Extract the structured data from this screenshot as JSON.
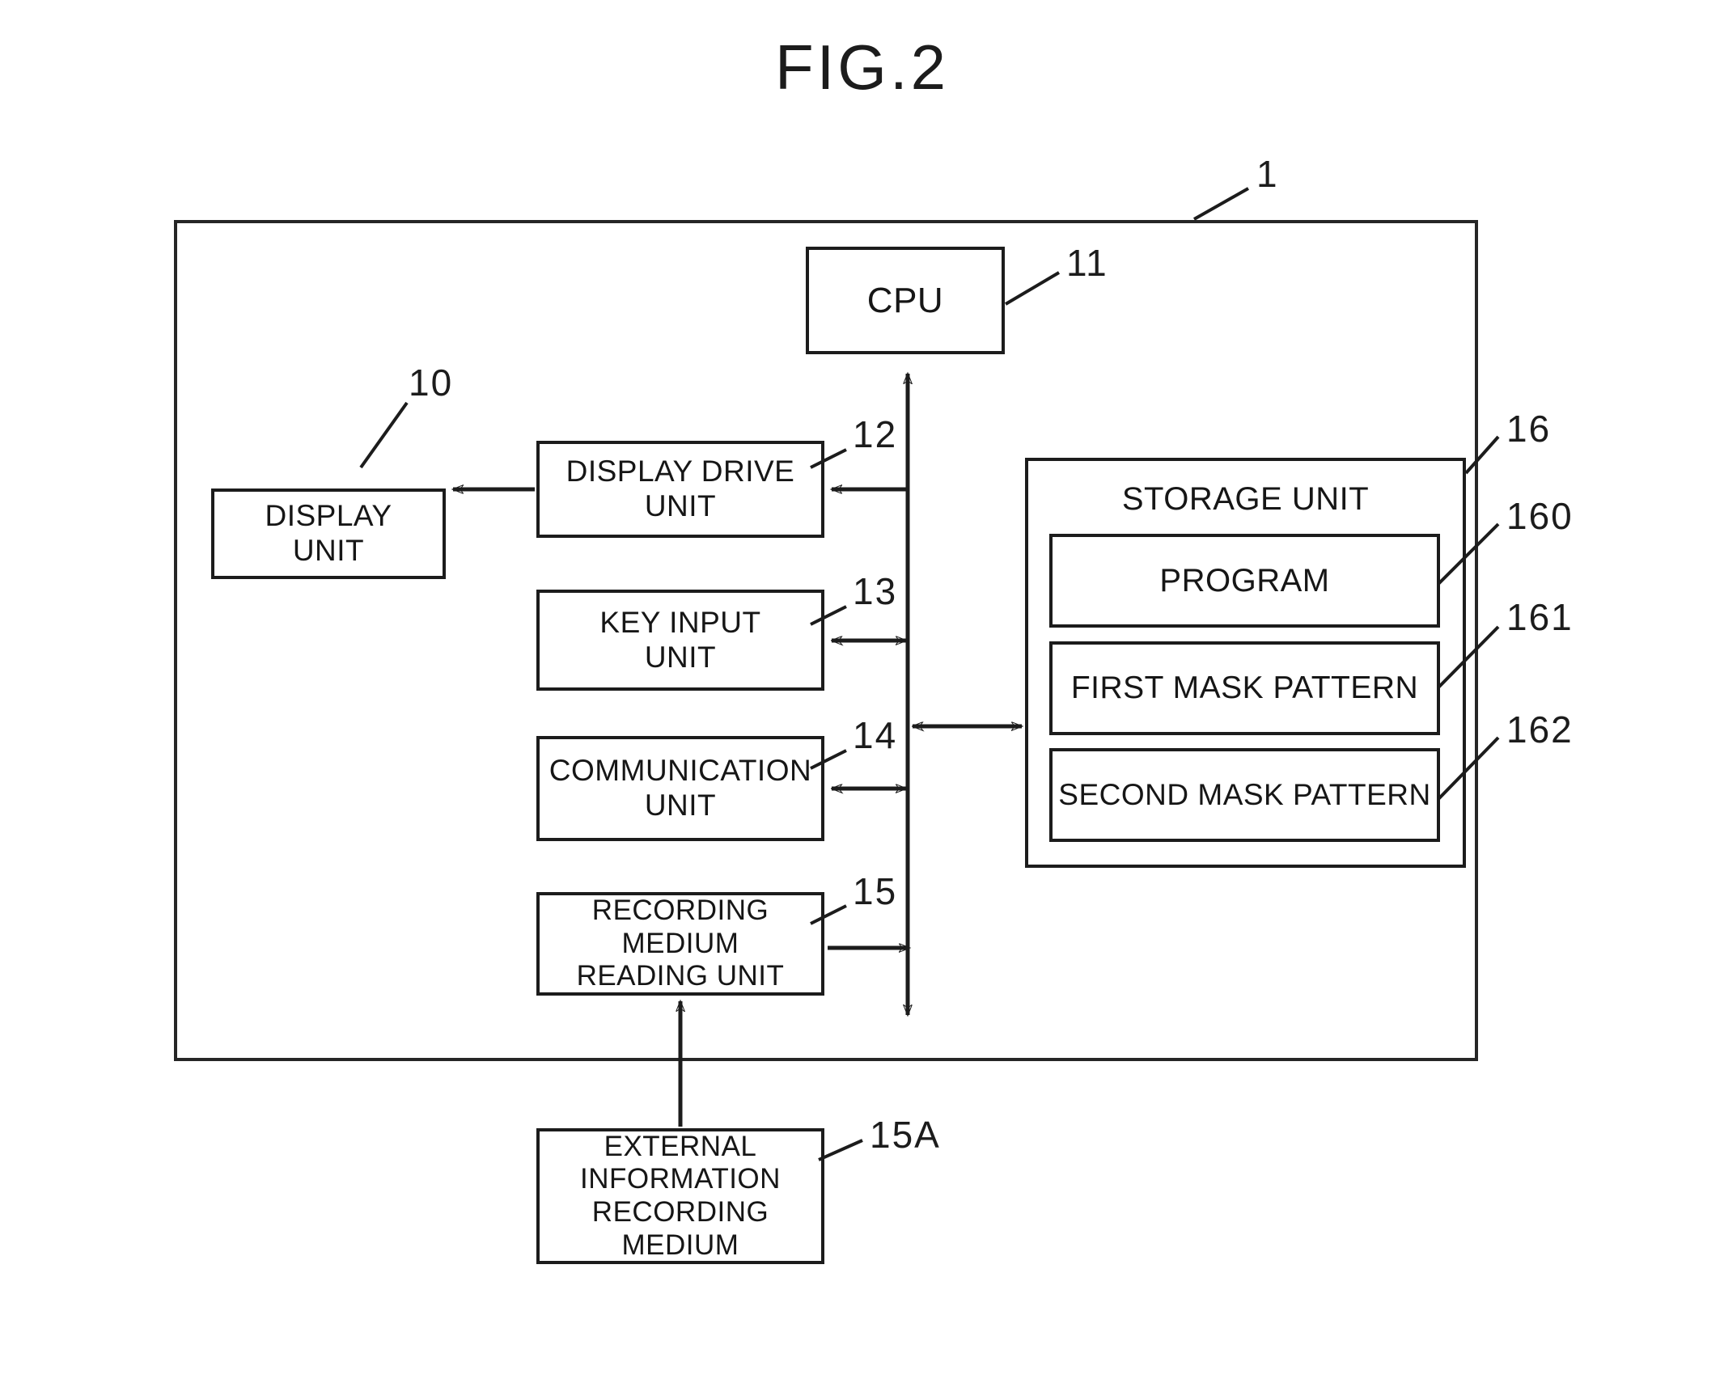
{
  "figure": {
    "title": "FIG.2",
    "type": "patent-block-diagram"
  },
  "outer_system": {
    "label_number": "1",
    "description": "System enclosure"
  },
  "blocks": {
    "cpu": {
      "label": "CPU",
      "ref": "11"
    },
    "display_unit": {
      "label": "DISPLAY\nUNIT",
      "line1": "DISPLAY",
      "line2": "UNIT",
      "ref": "10"
    },
    "display_drive_unit": {
      "line1": "DISPLAY DRIVE",
      "line2": "UNIT",
      "ref": "12"
    },
    "key_input_unit": {
      "line1": "KEY INPUT",
      "line2": "UNIT",
      "ref": "13"
    },
    "communication_unit": {
      "line1": "COMMUNICATION",
      "line2": "UNIT",
      "ref": "14"
    },
    "recording_medium_reading_unit": {
      "line1": "RECORDING MEDIUM",
      "line2": "READING UNIT",
      "ref": "15"
    },
    "external_information_recording_medium": {
      "line1": "EXTERNAL",
      "line2": "INFORMATION",
      "line3": "RECORDING MEDIUM",
      "ref": "15A"
    },
    "storage_unit": {
      "label": "STORAGE UNIT",
      "ref": "16"
    },
    "program": {
      "label": "PROGRAM",
      "ref": "160"
    },
    "first_mask_pattern": {
      "label": "FIRST MASK PATTERN",
      "ref": "161"
    },
    "second_mask_pattern": {
      "label": "SECOND MASK PATTERN",
      "ref": "162"
    }
  },
  "connections": [
    {
      "from": "display_drive_unit",
      "to": "display_unit",
      "direction": "one-way"
    },
    {
      "from": "bus",
      "to": "display_drive_unit",
      "direction": "one-way"
    },
    {
      "from": "bus",
      "to": "key_input_unit",
      "direction": "two-way"
    },
    {
      "from": "bus",
      "to": "communication_unit",
      "direction": "two-way"
    },
    {
      "from": "recording_medium_reading_unit",
      "to": "bus",
      "direction": "one-way"
    },
    {
      "from": "bus",
      "to": "storage_unit",
      "direction": "two-way"
    },
    {
      "from": "bus",
      "to": "cpu",
      "direction": "one-way"
    },
    {
      "from": "external_information_recording_medium",
      "to": "recording_medium_reading_unit",
      "direction": "one-way"
    }
  ],
  "colors": {
    "ink": "#1c1c1c",
    "background": "#ffffff"
  }
}
